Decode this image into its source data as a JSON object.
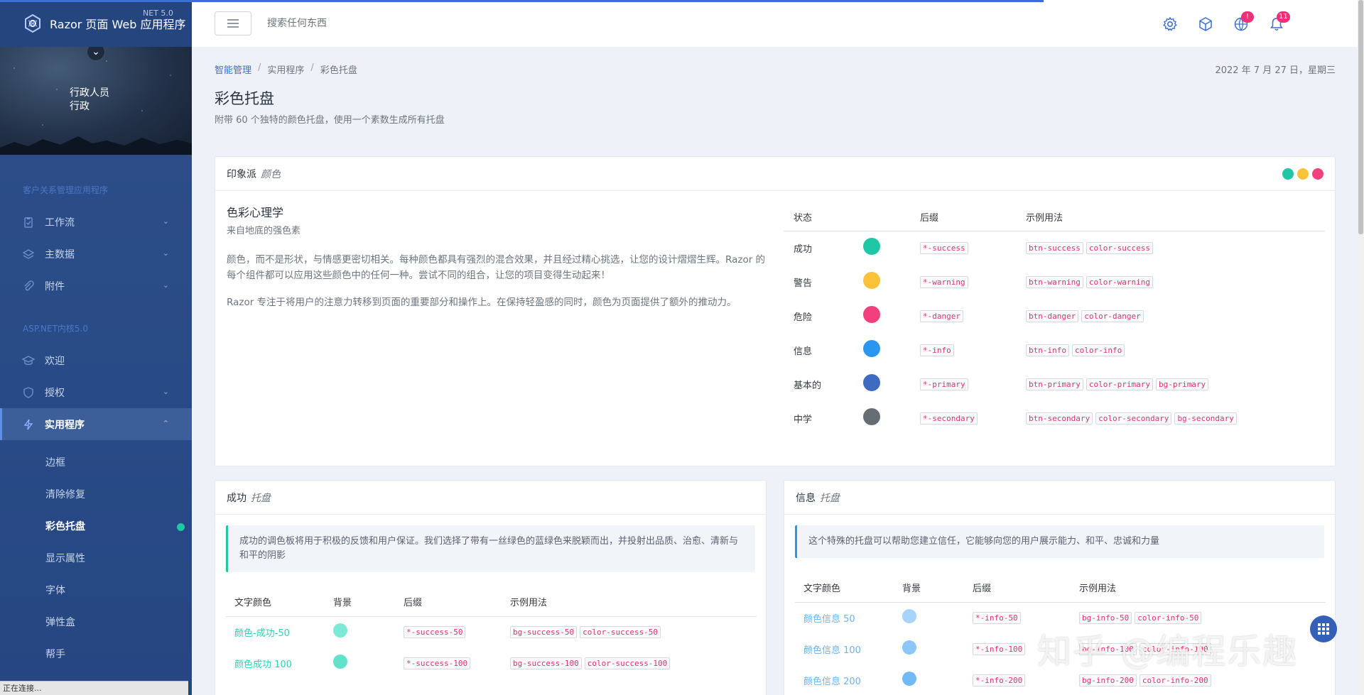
{
  "app": {
    "title": "Razor 页面 Web 应用程序",
    "version": "NET 5.0"
  },
  "profile": {
    "line1": "行政人员",
    "line2": "行政"
  },
  "sidebar": {
    "section1": "客户关系管理应用程序",
    "items1": [
      {
        "label": "工作流",
        "icon": "clipboard-icon"
      },
      {
        "label": "主数据",
        "icon": "layers-icon"
      },
      {
        "label": "附件",
        "icon": "paperclip-icon"
      }
    ],
    "section2": "ASP.NET内核5.0",
    "items2": [
      {
        "label": "欢迎",
        "icon": "graduation-cap-icon"
      },
      {
        "label": "授权",
        "icon": "shield-icon"
      },
      {
        "label": "实用程序",
        "icon": "bolt-icon"
      }
    ],
    "subitems": [
      "边框",
      "清除修复",
      "彩色托盘",
      "显示属性",
      "字体",
      "弹性盒",
      "帮手"
    ]
  },
  "search": {
    "placeholder": "搜索任何东西"
  },
  "header": {
    "globe_badge": "!",
    "bell_badge": "11"
  },
  "breadcrumb": {
    "c1": "智能管理",
    "c2": "实用程序",
    "c3": "彩色托盘"
  },
  "date": "2022 年 7 月 27 日，星期三",
  "page": {
    "title": "彩色托盘",
    "subtitle": "附带 60 个独特的颜色托盘，使用一个素数生成所有托盘"
  },
  "impression": {
    "head": "印象派",
    "head_em": "颜色",
    "dots": [
      "#1fc7a6",
      "#fbc13a",
      "#f2407e"
    ],
    "psych_title": "色彩心理学",
    "psych_sub": "来自地底的强色素",
    "p1": "颜色，而不是形状，与情感更密切相关。每种颜色都具有强烈的混合效果，并且经过精心挑选，让您的设计熠熠生辉。Razor 的每个组件都可以应用这些颜色中的任何一种。尝试不同的组合，让您的项目变得生动起来！",
    "p2": "Razor 专注于将用户的注意力转移到页面的重要部分和操作上。在保持轻盈感的同时，颜色为页面提供了额外的推动力。",
    "th": {
      "state": "状态",
      "suffix": "后缀",
      "usage": "示例用法"
    },
    "rows": [
      {
        "state": "成功",
        "color": "#1fc7a6",
        "suffix": "*-success",
        "usage": [
          "btn-success",
          "color-success"
        ]
      },
      {
        "state": "警告",
        "color": "#fbc13a",
        "suffix": "*-warning",
        "usage": [
          "btn-warning",
          "color-warning"
        ]
      },
      {
        "state": "危险",
        "color": "#f2407e",
        "suffix": "*-danger",
        "usage": [
          "btn-danger",
          "color-danger"
        ]
      },
      {
        "state": "信息",
        "color": "#2b96f0",
        "suffix": "*-info",
        "usage": [
          "btn-info",
          "color-info"
        ]
      },
      {
        "state": "基本的",
        "color": "#3e6ac2",
        "suffix": "*-primary",
        "usage": [
          "btn-primary",
          "color-primary",
          "bg-primary"
        ]
      },
      {
        "state": "中学",
        "color": "#666d74",
        "suffix": "*-secondary",
        "usage": [
          "btn-secondary",
          "color-secondary",
          "bg-secondary"
        ]
      }
    ]
  },
  "success_card": {
    "head": "成功",
    "head_em": "托盘",
    "note": "成功的调色板将用于积极的反馈和用户保证。我们选择了带有一丝绿色的蓝绿色来脱颖而出，并投射出品质、治愈、清新与和平的阴影",
    "th": {
      "text": "文字颜色",
      "bg": "背景",
      "suffix": "后缀",
      "usage": "示例用法"
    },
    "rows": [
      {
        "text": "颜色-成功-50",
        "color": "#7ee9d6",
        "suffix": "*-success-50",
        "usage": [
          "bg-success-50",
          "color-success-50"
        ]
      },
      {
        "text": "颜色成功 100",
        "color": "#62e2cb",
        "suffix": "*-success-100",
        "usage": [
          "bg-success-100",
          "color-success-100"
        ]
      }
    ]
  },
  "info_card": {
    "head": "信息",
    "head_em": "托盘",
    "note": "这个特殊的托盘可以帮助您建立信任，它能够向您的用户展示能力、和平、忠诚和力量",
    "th": {
      "text": "文字颜色",
      "bg": "背景",
      "suffix": "后缀",
      "usage": "示例用法"
    },
    "rows": [
      {
        "text": "颜色信息 50",
        "color": "#a6d4fa",
        "suffix": "*-info-50",
        "usage": [
          "bg-info-50",
          "color-info-50"
        ]
      },
      {
        "text": "颜色信息 100",
        "color": "#8ac6f7",
        "suffix": "*-info-100",
        "usage": [
          "bg-info-100",
          "color-info-100"
        ]
      },
      {
        "text": "颜色信息 200",
        "color": "#72baf5",
        "suffix": "*-info-200",
        "usage": [
          "bg-info-200",
          "color-info-200"
        ]
      }
    ]
  },
  "status_bar": "正在连接...",
  "watermark": "知乎 @编程乐趣",
  "colors": {
    "accent": "#3b6fd6",
    "success": "#1fc7a6",
    "info": "#2b96f0",
    "danger": "#f2407e"
  }
}
